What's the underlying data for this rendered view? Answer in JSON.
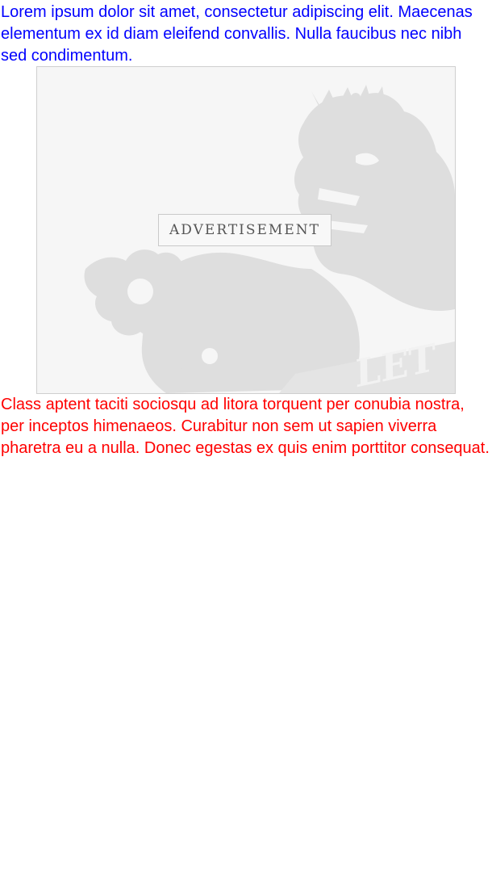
{
  "top_paragraph": {
    "text": "Lorem ipsum dolor sit amet, consectetur adipiscing elit. Maecenas elementum ex id diam eleifend convallis. Nulla faucibus nec nibh sed condimentum.",
    "color": "#0000ff"
  },
  "advertisement": {
    "label": "ADVERTISEMENT",
    "background_icon": "lion-crest-icon"
  },
  "bottom_paragraph": {
    "text": "Class aptent taciti sociosqu ad litora torquent per conubia nostra, per inceptos himenaeos. Curabitur non sem ut sapien viverra pharetra eu a nulla. Donec egestas ex quis enim porttitor consequat.",
    "color": "#ff0000"
  }
}
